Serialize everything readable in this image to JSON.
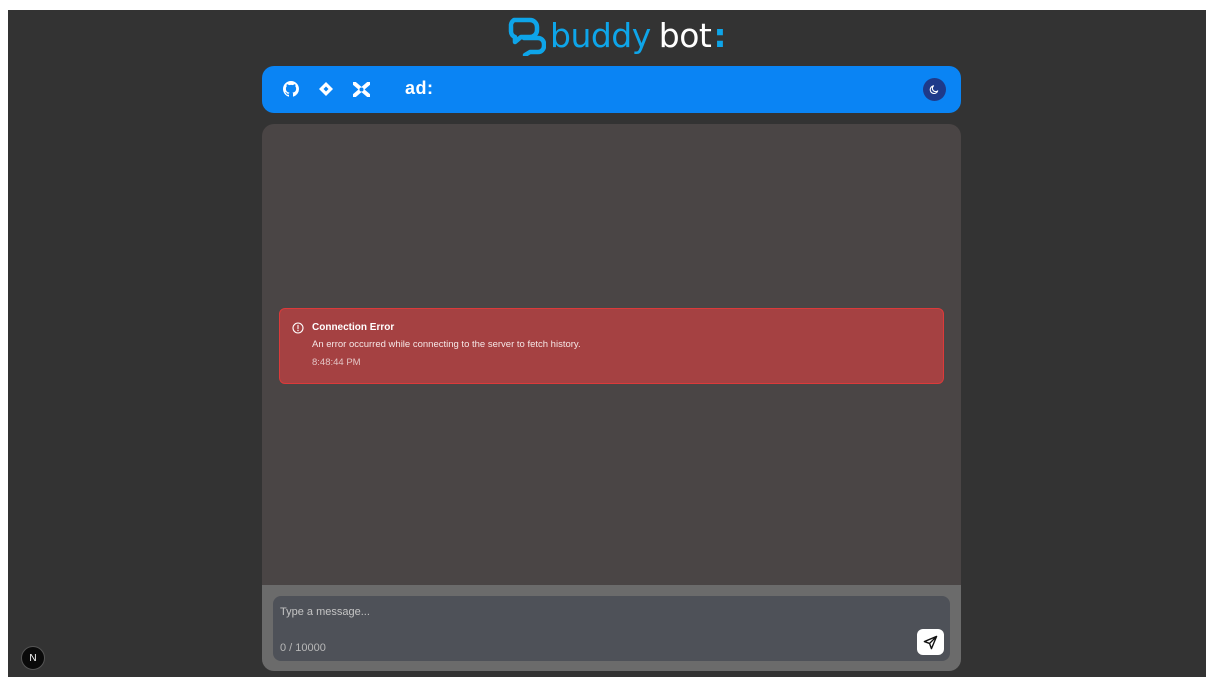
{
  "logo": {
    "part1": "buddy",
    "part2": "bot",
    "colon": ":"
  },
  "header": {
    "links": [
      {
        "icon": "github-icon"
      },
      {
        "icon": "diamond-icon"
      },
      {
        "icon": "x-icon"
      }
    ],
    "ad_label": "ad:",
    "theme_icon": "moon-icon"
  },
  "chat": {
    "error": {
      "title": "Connection Error",
      "message": "An error occurred while connecting to the server to fetch history.",
      "time": "8:48:44 PM"
    }
  },
  "composer": {
    "placeholder": "Type a message...",
    "char_count": "0 / 10000"
  },
  "next_badge": {
    "label": "N"
  },
  "colors": {
    "accent": "#0a84f4",
    "brand": "#0ea5e9",
    "error_bg": "#a54142",
    "error_border": "#dc3a3a",
    "page_bg": "#333333",
    "chat_bg": "#4a4545"
  }
}
